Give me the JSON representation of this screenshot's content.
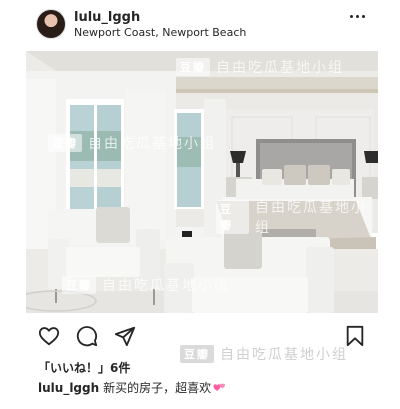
{
  "post": {
    "username": "lulu_lggh",
    "location": "Newport Coast, Newport Beach",
    "likes_text": "「いいね！」6件",
    "caption_user": "lulu_lggh",
    "caption_text": "新买的房子，超喜欢"
  },
  "watermark": {
    "badge": "豆瓣",
    "text": "自由吃瓜基地小组"
  },
  "icons": {
    "more": "more-horizontal-icon",
    "like": "heart-icon",
    "comment": "comment-icon",
    "share": "send-icon",
    "save": "bookmark-icon",
    "caption_emoji": "pink-hearts-emoji"
  },
  "colors": {
    "text": "#262626",
    "emoji_pink": "#ff5fa2"
  }
}
